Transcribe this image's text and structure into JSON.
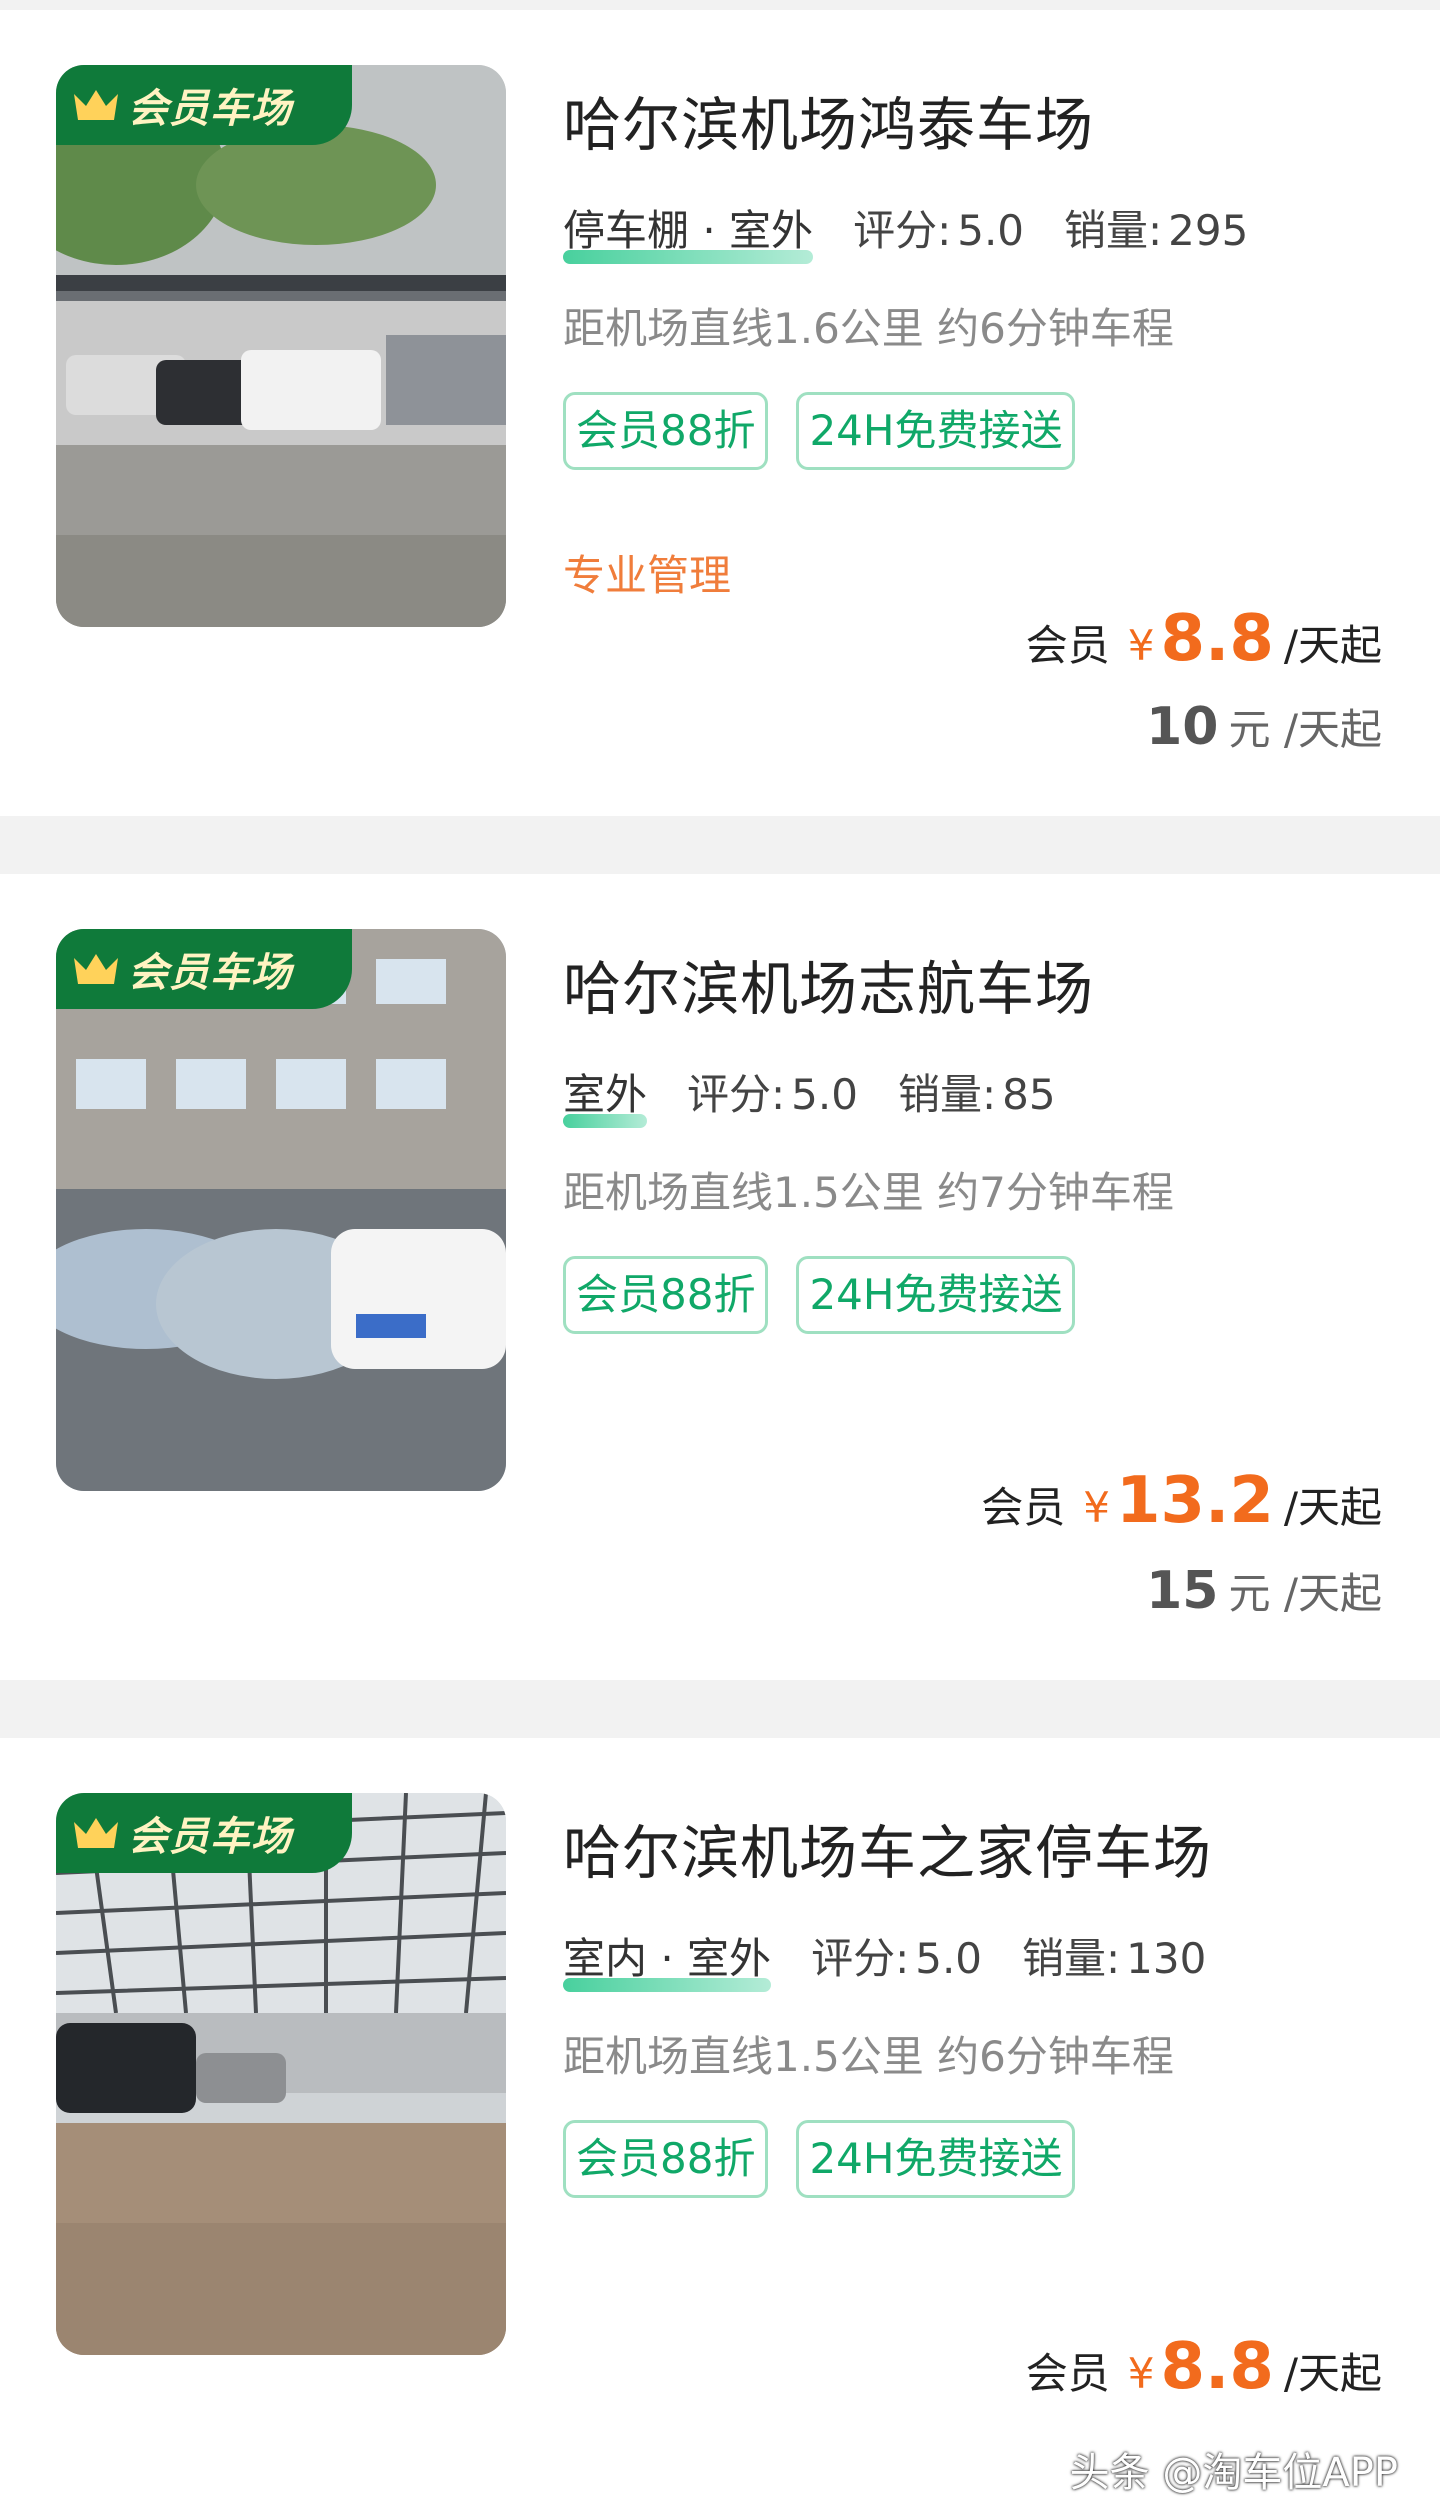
{
  "lots": [
    {
      "badge": "会员车场",
      "name": "哈尔滨机场鸿泰车场",
      "type": "停车棚 · 室外",
      "rating_label": "评分:",
      "rating": "5.0",
      "sales_label": "销量:",
      "sales": "295",
      "distance": "距机场直线1.6公里 约6分钟车程",
      "tags": [
        "会员88折",
        "24H免费接送"
      ],
      "extra": "专业管理",
      "member_label": "会员",
      "currency": "¥",
      "member_price": "8.8",
      "price_unit": "/天起",
      "original_price": "10",
      "original_unit": "元 /天起"
    },
    {
      "badge": "会员车场",
      "name": "哈尔滨机场志航车场",
      "type": "室外",
      "rating_label": "评分:",
      "rating": "5.0",
      "sales_label": "销量:",
      "sales": "85",
      "distance": "距机场直线1.5公里 约7分钟车程",
      "tags": [
        "会员88折",
        "24H免费接送"
      ],
      "member_label": "会员",
      "currency": "¥",
      "member_price": "13.2",
      "price_unit": "/天起",
      "original_price": "15",
      "original_unit": "元 /天起"
    },
    {
      "badge": "会员车场",
      "name": "哈尔滨机场车之家停车场",
      "type": "室内 · 室外",
      "rating_label": "评分:",
      "rating": "5.0",
      "sales_label": "销量:",
      "sales": "130",
      "distance": "距机场直线1.5公里 约6分钟车程",
      "tags": [
        "会员88折",
        "24H免费接送"
      ],
      "member_label": "会员",
      "currency": "¥",
      "member_price": "8.8",
      "price_unit": "/天起"
    }
  ],
  "watermark": "头条 @淘车位APP",
  "colors": {
    "accent_green": "#10a868",
    "badge_green": "#0f7a3a",
    "price_orange": "#f26b1d",
    "extra_orange": "#f07d3b"
  }
}
